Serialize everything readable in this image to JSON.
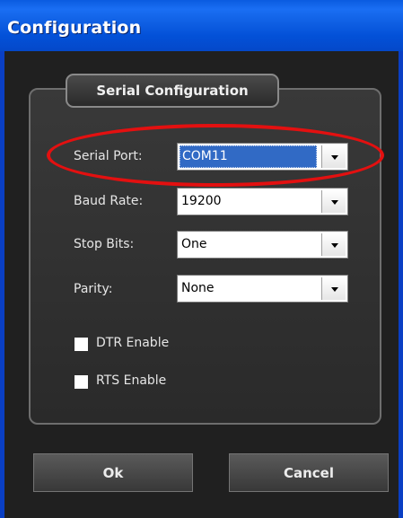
{
  "window": {
    "title": "Configuration"
  },
  "group": {
    "label": "Serial Configuration"
  },
  "fields": [
    {
      "label": "Serial Port:",
      "value": "COM11"
    },
    {
      "label": "Baud Rate:",
      "value": "19200"
    },
    {
      "label": "Stop Bits:",
      "value": "One"
    },
    {
      "label": "Parity:",
      "value": "None"
    }
  ],
  "checkboxes": [
    {
      "label": "DTR Enable",
      "checked": false
    },
    {
      "label": "RTS Enable",
      "checked": false
    }
  ],
  "buttons": {
    "ok": "Ok",
    "cancel": "Cancel"
  },
  "colors": {
    "titlebar": "#0a5be0",
    "annotation": "#e31010",
    "selection": "#316ac5"
  }
}
